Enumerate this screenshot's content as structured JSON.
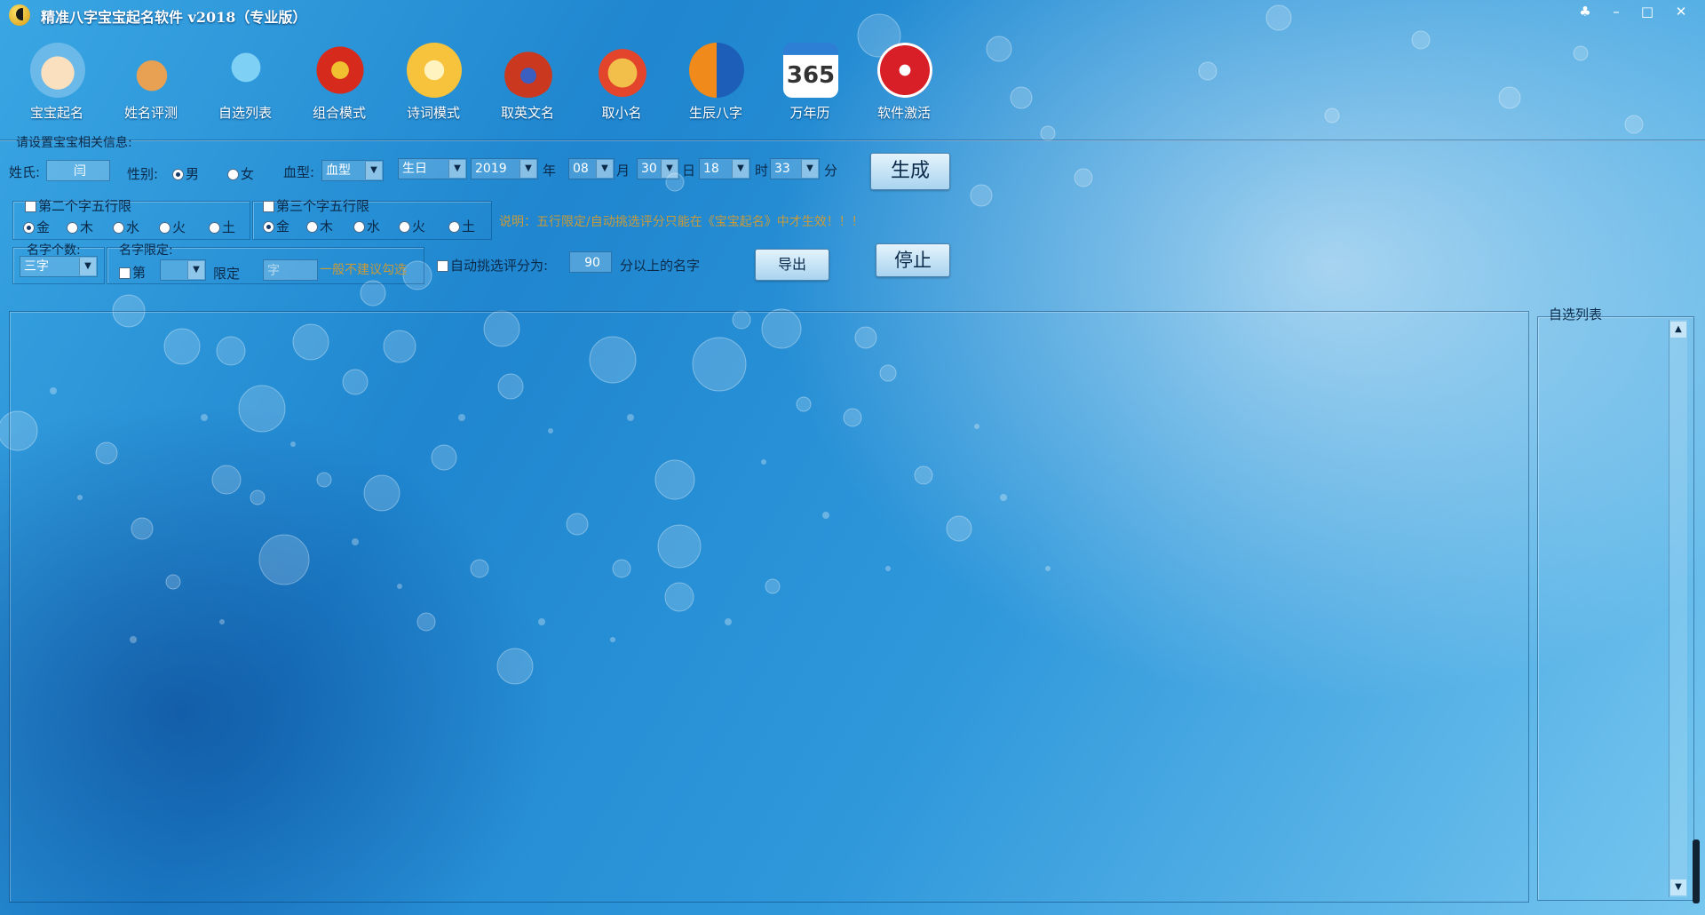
{
  "window": {
    "title": "精准八字宝宝起名软件 v2018（专业版）",
    "buttons": [
      "skin",
      "minimize",
      "maximize",
      "close"
    ]
  },
  "toolbar": [
    {
      "label": "宝宝起名",
      "icon": "baby-face-icon",
      "color": "#f4c27a"
    },
    {
      "label": "姓名评测",
      "icon": "rabbit-icon",
      "color": "#d9893a"
    },
    {
      "label": "自选列表",
      "icon": "bird-book-icon",
      "color": "#4fb3e8"
    },
    {
      "label": "组合模式",
      "icon": "lantern-icon",
      "color": "#d62b1c"
    },
    {
      "label": "诗词模式",
      "icon": "book-icon",
      "color": "#f7c23c"
    },
    {
      "label": "取英文名",
      "icon": "eagle-emblem-icon",
      "color": "#c9381f"
    },
    {
      "label": "取小名",
      "icon": "cartoon-face-icon",
      "color": "#e3452c"
    },
    {
      "label": "生辰八字",
      "icon": "yin-yang-icon",
      "color": "#f08a1a"
    },
    {
      "label": "万年历",
      "icon": "calendar-365-icon",
      "color": "#2d7fd6"
    },
    {
      "label": "软件激活",
      "icon": "lock-icon",
      "color": "#d81e26"
    }
  ],
  "section_label": "请设置宝宝相关信息:",
  "form": {
    "surname_label": "姓氏:",
    "surname_value": "闫",
    "gender_label": "性别:",
    "gender_male": "男",
    "gender_female": "女",
    "blood_label": "血型:",
    "blood_value": "血型",
    "birthday_value": "生日",
    "year_value": "2019",
    "year_unit": "年",
    "month_value": "08",
    "month_unit": "月",
    "day_value": "30",
    "day_unit": "日",
    "hour_value": "18",
    "hour_unit": "时",
    "minute_value": "33",
    "minute_unit": "分",
    "generate_label": "生成",
    "second_char_label": "第二个字五行限",
    "third_char_label": "第三个字五行限",
    "elements": [
      "金",
      "木",
      "水",
      "火",
      "土"
    ],
    "note": "说明：五行限定/自动挑选评分只能在《宝宝起名》中才生效！！！",
    "name_count_label": "名字个数:",
    "name_count_value": "三字",
    "name_limit_label": "名字限定:",
    "name_limit_check": "第",
    "name_limit_value": "",
    "name_limit_word": "限定",
    "name_limit_placeholder": "字",
    "name_limit_hint": "一般不建议勾选",
    "auto_pick_label": "自动挑选评分为:",
    "auto_pick_value": "90",
    "auto_pick_suffix": "分以上的名字",
    "export_label": "导出",
    "stop_label": "停止"
  },
  "side_panel": {
    "title": "自选列表"
  }
}
